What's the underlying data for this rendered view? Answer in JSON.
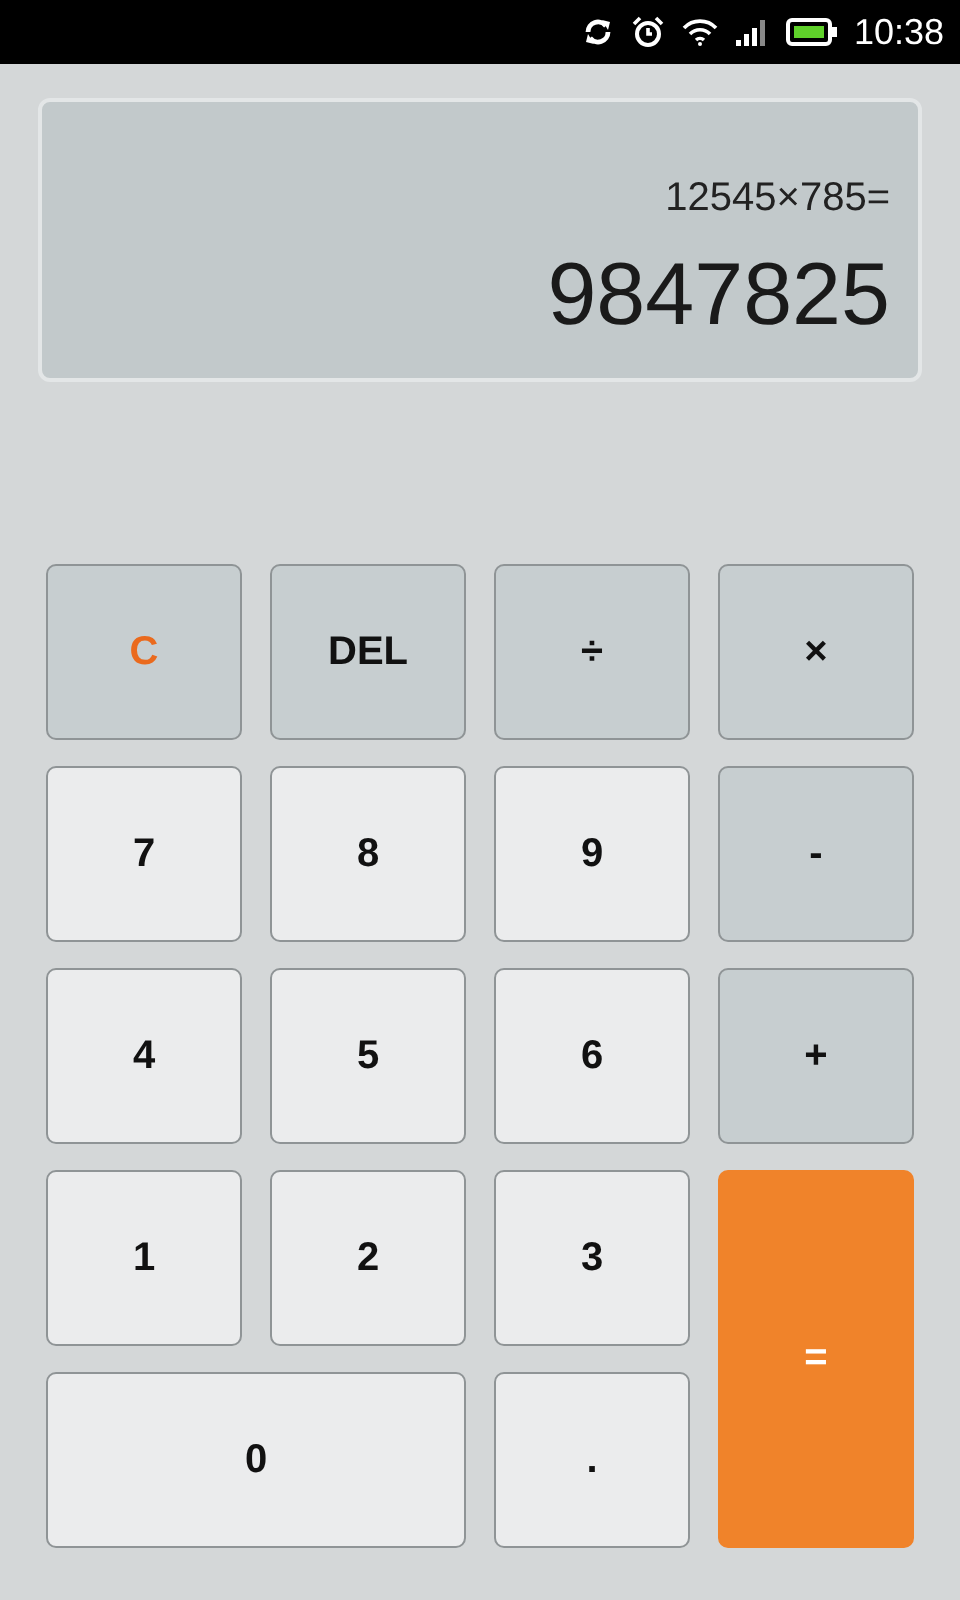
{
  "status_bar": {
    "time": "10:38"
  },
  "display": {
    "expression": "12545×785=",
    "result": "9847825"
  },
  "keys": [
    {
      "label": "C",
      "kind": "clear"
    },
    {
      "label": "DEL",
      "kind": "operator"
    },
    {
      "label": "÷",
      "kind": "operator"
    },
    {
      "label": "×",
      "kind": "operator"
    },
    {
      "label": "7",
      "kind": "digit"
    },
    {
      "label": "8",
      "kind": "digit"
    },
    {
      "label": "9",
      "kind": "digit"
    },
    {
      "label": "-",
      "kind": "operator"
    },
    {
      "label": "4",
      "kind": "digit"
    },
    {
      "label": "5",
      "kind": "digit"
    },
    {
      "label": "6",
      "kind": "digit"
    },
    {
      "label": "+",
      "kind": "operator"
    },
    {
      "label": "1",
      "kind": "digit"
    },
    {
      "label": "2",
      "kind": "digit"
    },
    {
      "label": "3",
      "kind": "digit"
    },
    {
      "label": "=",
      "kind": "equals"
    },
    {
      "label": "0",
      "kind": "wide"
    },
    {
      "label": ".",
      "kind": "digit"
    }
  ]
}
